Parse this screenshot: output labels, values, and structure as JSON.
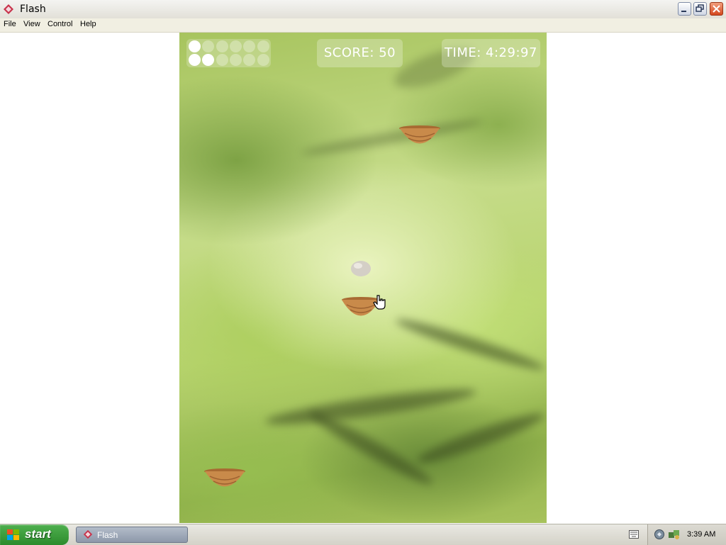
{
  "window": {
    "title": "Flash",
    "icon": "flash-icon",
    "controls": [
      "minimize-icon",
      "restore-icon",
      "close-icon"
    ]
  },
  "menu": {
    "items": [
      {
        "label": "File"
      },
      {
        "label": "View"
      },
      {
        "label": "Control"
      },
      {
        "label": "Help"
      }
    ]
  },
  "game": {
    "lives": {
      "total": 12,
      "remaining": 3
    },
    "score": "SCORE:  50",
    "time": "TIME:  4:29:97",
    "nests": 3,
    "egg": "egg",
    "cursor": "hand-cursor-icon"
  },
  "taskbar": {
    "start_label": "start",
    "tasks": [
      {
        "label": "Flash",
        "icon": "flash-icon"
      }
    ],
    "tray_icons": [
      "keyboard-icon",
      "network-icon",
      "security-icon"
    ],
    "clock": "3:39 AM"
  },
  "colors": {
    "foliage": "#b8d46f",
    "nest": "#c98a4a",
    "start_green": "#3a9d3a",
    "close_red": "#d4471e"
  }
}
